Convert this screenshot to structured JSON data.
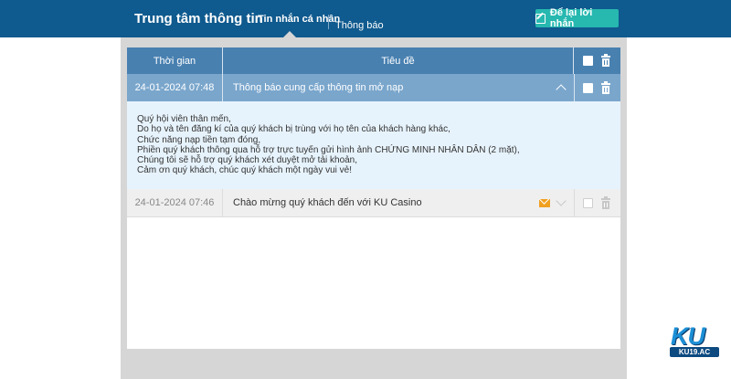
{
  "header": {
    "title": "Trung tâm thông tin",
    "tabs": [
      {
        "label": "Tin nhắn cá nhân",
        "active": true
      },
      {
        "label": "Thông báo",
        "active": false
      }
    ],
    "leave_message_label": "Để lại lời nhắn"
  },
  "table": {
    "columns": {
      "time": "Thời gian",
      "subject": "Tiêu đề"
    },
    "rows": [
      {
        "date": "24-01-2024 07:48",
        "subject": "Thông báo cung cấp thông tin mở nạp",
        "expanded": true,
        "body": [
          "Quý hội viên thân mến,",
          "Do họ và tên đăng kí của quý khách bị trùng với họ tên của khách hàng khác,",
          "Chức năng nạp tiền tạm đóng,",
          "Phiền quý khách thông qua hỗ trợ trực tuyến gửi hình ảnh CHỨNG MINH NHÂN DÂN (2 mặt),",
          "Chúng tôi sẽ hỗ trợ quý khách xét duyệt mở tải khoản,",
          "Cảm ơn quý khách, chúc quý khách một ngày vui vẻ!"
        ]
      },
      {
        "date": "24-01-2024 07:46",
        "subject": "Chào mừng quý khách đến với KU Casino",
        "expanded": false,
        "unread_icon": "mail-icon"
      }
    ]
  },
  "logo": {
    "brand": "KU",
    "domain": "KU19.AC"
  },
  "colors": {
    "topbar": "#0f5a8e",
    "header_row": "#4880b0",
    "selected_row": "#7aa6cc",
    "message_body": "#e7f3fc",
    "button": "#27b8b0",
    "mail_icon": "#f0a020"
  }
}
